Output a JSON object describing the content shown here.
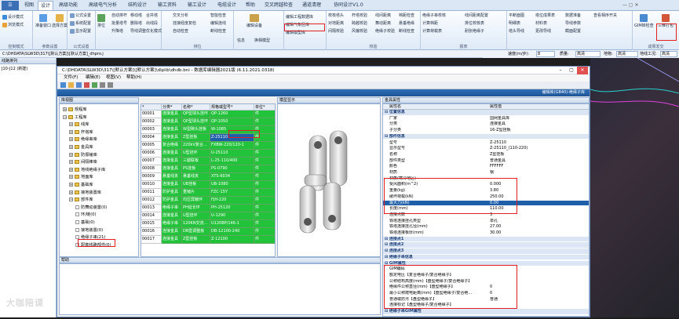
{
  "ribbon": {
    "tabs": [
      "视图",
      "设计",
      "高级功能",
      "高级电气分析",
      "结构设计",
      "输工资料",
      "输工设计",
      "电缆设计",
      "帮助",
      "交叉跨越检查",
      "通道清理",
      "协同设计V1.0"
    ],
    "active_tab": "设计",
    "groups": [
      {
        "label": "控制模式",
        "items": [
          "设计模式",
          "浏览模式"
        ]
      },
      {
        "label": "参数设置",
        "items": [
          "准备窗口",
          "选择方案"
        ]
      },
      {
        "label": "公式设置",
        "items": [
          "公式设置",
          "系统配置",
          "显示配置"
        ]
      },
      {
        "label": "",
        "items": [
          "排位",
          "自动排杆",
          "移动塔",
          "合并塔",
          "批量塔号",
          "删除塔",
          "升降塔",
          "导线调整",
          "出线段",
          "优化模式"
        ]
      },
      {
        "label": "排位",
        "items": [
          "交叉分析",
          "挂接经度复检",
          "自动检查",
          "智能检查",
          "编辑连线",
          "断线检查"
        ]
      },
      {
        "label": "",
        "items": [
          "编辑工程数据库",
          "编辑气象区库",
          "编辑模型库"
        ]
      },
      {
        "label": "",
        "items": [
          "编辑设备",
          "信息",
          "换相模型"
        ]
      },
      {
        "label": "校验",
        "items": [
          "校核塔头",
          "杆塔校验",
          "对地距离",
          "跨越校验",
          "间隔校验",
          "风偏校验",
          "断线检查",
          "档距检查",
          "线间距离",
          "舞动距离",
          "绝缘子校验",
          "悬垂绝缘",
          "计算荷载",
          "间隔检查",
          "线间检查",
          "线间检修"
        ]
      },
      {
        "label": "报表",
        "items": [
          "绝缘子串校核",
          "计算档距",
          "计算荷载表",
          "绝缘子串参数",
          "线间距离配置",
          "排位校核表",
          "杆塔明细",
          "耐张绝缘子",
          "绝缘子串"
        ]
      },
      {
        "label": "",
        "items": [
          "平断面图",
          "塔位成果表",
          "数据准备",
          "查看相序开关",
          "明细表",
          "材料表",
          "塔头导线",
          "更改导线",
          "导线参数",
          "截面配置"
        ]
      },
      {
        "label": "成果发交",
        "items": [
          "GIM转检查",
          "三维打包"
        ]
      }
    ],
    "highlighted_button": "编辑工程数据库"
  },
  "pathbar": {
    "text": "C:\\DHDATA\\SLW3D\\317\\[默认方案]\\[默认方案]_dhpro.j"
  },
  "status": {
    "speed_label": "速度(m/步):",
    "speed_value": "8",
    "quality_label": "质量:",
    "quality_value": "高清",
    "terrain_label": "地物:",
    "terrain_value": "高清",
    "terrain2_label": "地线工况:",
    "terrain2_value": "高清"
  },
  "left_panel": {
    "title": "线路排列",
    "tree_root": "J10-J12 (新建)"
  },
  "editor": {
    "title": "C:\\DHDATA\\SLW3D\\317\\[默认方案]\\[默认方案]\\dlplib\\dhdb.bni - 数据库编辑器2021版 (6.11.2021.0318)",
    "menus": [
      "文件(F)",
      "编辑(E)",
      "视图(V)",
      "帮助(H)"
    ],
    "lib_header": "编辑库(GB40)-绝缘子库",
    "tree_title": "库视图",
    "tree": [
      {
        "label": "规程库",
        "level": 1,
        "expanded": false
      },
      {
        "label": "工程库",
        "level": 1,
        "expanded": true
      },
      {
        "label": "线库",
        "level": 2
      },
      {
        "label": "杆塔库",
        "level": 2
      },
      {
        "label": "绝缘串库",
        "level": 2
      },
      {
        "label": "金具库",
        "level": 2
      },
      {
        "label": "防振锤库",
        "level": 2
      },
      {
        "label": "间隔棒库",
        "level": 2
      },
      {
        "label": "地线绝缘子库",
        "level": 2
      },
      {
        "label": "地面库",
        "level": 2
      },
      {
        "label": "基础库",
        "level": 2
      },
      {
        "label": "接地装置库",
        "level": 2
      },
      {
        "label": "部件库",
        "level": 2,
        "expanded": true
      },
      {
        "label": "防舞动装置(0)",
        "level": 3
      },
      {
        "label": "环/链(0)",
        "level": 3
      },
      {
        "label": "基础(0)",
        "level": 3
      },
      {
        "label": "接地装置(0)",
        "level": 3
      },
      {
        "label": "绝缘子串(21)",
        "level": 3,
        "highlighted": true
      },
      {
        "label": "配套线路部件(0)",
        "level": 3
      }
    ],
    "grid_headers": [
      "*",
      "分类*",
      "名称*",
      "规格或型号*",
      "单位*"
    ],
    "grid_rows": [
      [
        "00001",
        "连接金具",
        "QP型球头挂环",
        "QP-1260",
        "件"
      ],
      [
        "00002",
        "连接金具",
        "QP型球头挂环",
        "QP-1050",
        "件"
      ],
      [
        "00003",
        "连接金具",
        "W型碗头挂板",
        "W-1085",
        "件"
      ],
      [
        "00004",
        "连接金具",
        "Z型挂板",
        "Z-25110",
        "件"
      ],
      [
        "00005",
        "复合绝缘",
        "220kV复合...",
        "FXBW-220/120-1",
        "件"
      ],
      [
        "00006",
        "连接金具",
        "U型挂环",
        "U-25110",
        "件"
      ],
      [
        "00007",
        "连接金具",
        "三腿联板",
        "L-25-110/400",
        "件"
      ],
      [
        "00008",
        "连接金具",
        "PS挂板",
        "PS-0790",
        "件"
      ],
      [
        "00009",
        "悬垂线夹",
        "悬垂线夹",
        "XTS-6034",
        "件"
      ],
      [
        "00010",
        "连接金具",
        "UB挂板",
        "UB-1080",
        "件"
      ],
      [
        "00011",
        "防护金具",
        "重锤片",
        "FZC-15Y",
        "件"
      ],
      [
        "00012",
        "防护金具",
        "均压屏蔽环",
        "FJH-220",
        "件"
      ],
      [
        "00013",
        "绝缘子串",
        "PH延长环",
        "PH-25120",
        "件"
      ],
      [
        "00014",
        "连接金具",
        "U型挂环",
        "U-1290",
        "件"
      ],
      [
        "00015",
        "绝缘子串",
        "120KN交流...",
        "U120BP/146-1",
        "件"
      ],
      [
        "00016",
        "连接金具",
        "DB型调整板",
        "DB-12100-240",
        "件"
      ],
      [
        "00017",
        "连接金具",
        "Z型挂板",
        "Z-12100",
        "件"
      ]
    ],
    "model_title": "模型显示",
    "prop_title": "金具属性",
    "prop_headers": [
      "属性名",
      "属性值"
    ],
    "props": [
      {
        "type": "cat",
        "name": "位置信息",
        "value": ""
      },
      {
        "type": "row",
        "name": "厂家",
        "value": "国网金具库"
      },
      {
        "type": "row",
        "name": "分类",
        "value": "连接金具"
      },
      {
        "type": "row",
        "name": "子分类",
        "value": "16-Z型挂板"
      },
      {
        "type": "cat",
        "name": "部件信息",
        "value": ""
      },
      {
        "type": "row",
        "name": "型号",
        "value": "Z-25110"
      },
      {
        "type": "row",
        "name": "显示型号",
        "value": "Z-25110_(110-220)"
      },
      {
        "type": "row",
        "name": "名称",
        "value": "Z型挂板"
      },
      {
        "type": "row",
        "name": "部件类型",
        "value": "普通金具"
      },
      {
        "type": "row",
        "name": "颜色",
        "value": "FFFFFF"
      },
      {
        "type": "row",
        "name": "材质",
        "value": "钢"
      },
      {
        "type": "row",
        "name": "材质(寒冷地区)",
        "value": "--"
      },
      {
        "type": "row",
        "name": "受风面积(m^2)",
        "value": "0.000"
      },
      {
        "type": "row",
        "name": "重量(kg)",
        "value": "3.80"
      },
      {
        "type": "row",
        "name": "破坏荷载(kN)",
        "value": "250.00"
      },
      {
        "type": "row",
        "name": "最大力(kN)",
        "value": "0.00",
        "selected": true
      },
      {
        "type": "row",
        "name": "长度(mm)",
        "value": "110.00"
      },
      {
        "type": "row",
        "name": "连接点数",
        "value": "3"
      },
      {
        "type": "row",
        "name": "铁塔连接挂孔类型",
        "value": "单孔"
      },
      {
        "type": "row",
        "name": "铁塔连接挂孔径(mm)",
        "value": "27.00"
      },
      {
        "type": "row",
        "name": "铁塔连接板厚(mm)",
        "value": "30.00"
      },
      {
        "type": "cat",
        "name": "连接点1",
        "value": ""
      },
      {
        "type": "cat",
        "name": "连接点2",
        "value": ""
      },
      {
        "type": "cat",
        "name": "连接点3",
        "value": ""
      },
      {
        "type": "cat",
        "name": "绝缘子串信息",
        "value": ""
      },
      {
        "type": "cat",
        "name": "GIM属性",
        "value": ""
      },
      {
        "type": "row",
        "name": "GIM编码",
        "value": ""
      },
      {
        "type": "row",
        "name": "额定电压【复合绝缘子/复合绝缘子】",
        "value": ""
      },
      {
        "type": "row",
        "name": "公称结构高度(mm)【盘型绝缘子/复合绝缘子】",
        "value": ""
      },
      {
        "type": "row",
        "name": "绝缘件公称直径(mm)【盘型绝缘子】",
        "value": "0"
      },
      {
        "type": "row",
        "name": "最小公称爬电距离(mm)【盘型绝缘子/复合绝...",
        "value": "0"
      },
      {
        "type": "row",
        "name": "普通或防污【盘型绝缘子】",
        "value": "普通"
      },
      {
        "type": "row",
        "name": "连接标记【盘型绝缘子/复合绝缘子】",
        "value": ""
      },
      {
        "type": "cat",
        "name": "绝缘子串GIM属性",
        "value": ""
      }
    ],
    "help_title": "帮助"
  },
  "watermark": "大咖陪课",
  "colors": {
    "accent": "#1f5ea8",
    "grid_green": "#22c33a",
    "highlight_red": "#e02020"
  }
}
